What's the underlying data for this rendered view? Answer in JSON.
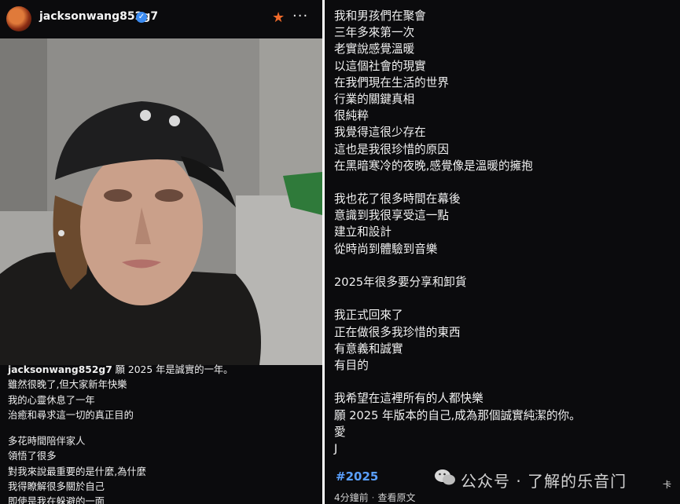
{
  "post": {
    "username": "jacksonwang852g7",
    "caption_lead": "願 2025 年是誠實的一年。",
    "caption_lines": [
      "雖然很晚了,但大家新年快樂",
      "我的心靈休息了一年",
      "治癒和尋求這一切的真正目的"
    ],
    "caption_lines_2": [
      "多花時間陪伴家人",
      "領悟了很多",
      "對我來說最重要的是什麼,為什麼",
      "我得瞭解很多關於自己",
      "即使是我在躲避的一面"
    ]
  },
  "poem": {
    "stanza1": [
      "我和男孩們在聚會",
      "三年多來第一次",
      "老實說感覺溫暖",
      "以這個社會的現實",
      "在我們現在生活的世界",
      "行業的關鍵真相",
      "很純粹",
      "我覺得這很少存在",
      "這也是我很珍惜的原因",
      "在黑暗寒冷的夜晚,感覺像是溫暖的擁抱"
    ],
    "stanza2": [
      "我也花了很多時間在幕後",
      "意識到我很享受這一點",
      "建立和設計",
      "從時尚到體驗到音樂"
    ],
    "stanza3": [
      "2025年很多要分享和卸貨"
    ],
    "stanza4": [
      "我正式回來了",
      "正在做很多我珍惜的東西",
      "有意義和誠實",
      "有目的"
    ],
    "stanza5": [
      "我希望在這裡所有的人都快樂",
      "願 2025 年版本的自己,成為那個誠實純潔的你。",
      "愛",
      "J"
    ]
  },
  "hashtag": "#2025",
  "meta": {
    "time": "4分鐘前",
    "sep": "·",
    "view_original": "查看原文"
  },
  "watermark": {
    "text": "公众号 · 了解的乐音门",
    "edge": "卡"
  },
  "icons": {
    "verified": "verified-badge-icon",
    "star": "star-icon",
    "more": "more-options-icon"
  },
  "colors": {
    "accent_blue": "#5aa0ff",
    "star_orange": "#f06a2a",
    "verified_blue": "#3b8bf0"
  }
}
